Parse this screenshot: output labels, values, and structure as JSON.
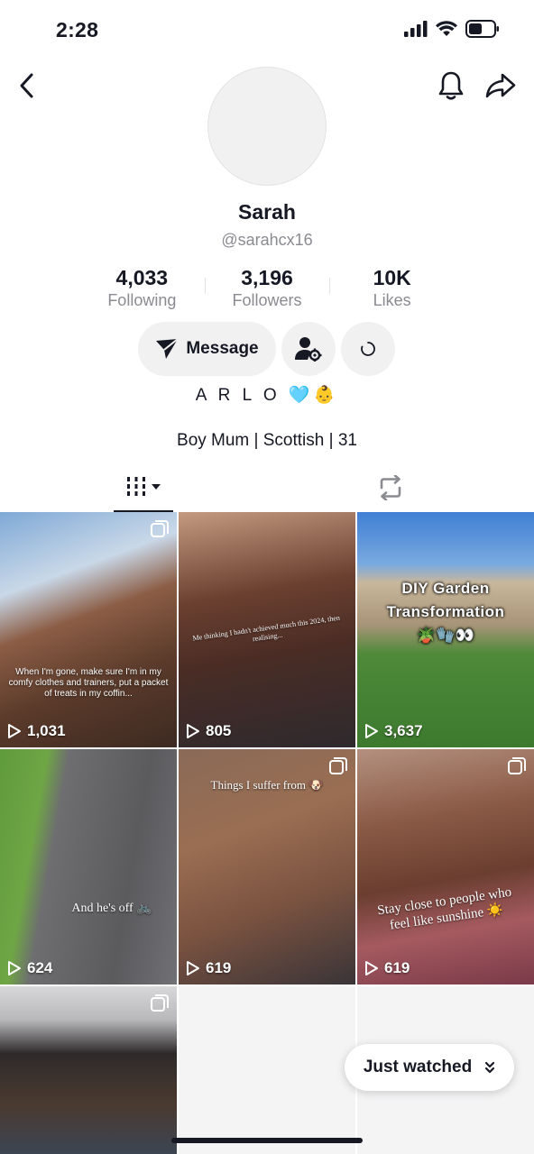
{
  "status_bar": {
    "time": "2:28"
  },
  "profile": {
    "display_name": "Sarah",
    "handle": "@sarahcx16",
    "bio_title": "A R L O 🩵👶",
    "bio_line": "Boy Mum | Scottish | 31"
  },
  "stats": [
    {
      "value": "4,033",
      "label": "Following"
    },
    {
      "value": "3,196",
      "label": "Followers"
    },
    {
      "value": "10K",
      "label": "Likes"
    }
  ],
  "actions": {
    "message_label": "Message"
  },
  "videos": [
    {
      "views": "1,031",
      "caption": "When I'm gone, make sure I'm in my comfy clothes and trainers, put a packet of treats in my coffin..."
    },
    {
      "views": "805",
      "caption": "Me thinking I hadn't achieved much this 2024, then realising..."
    },
    {
      "views": "3,637",
      "caption": "DIY Garden Transformation 🪴🧤👀"
    },
    {
      "views": "624",
      "caption": "And he's off 🚲"
    },
    {
      "views": "619",
      "caption": "Things I suffer from 🐶"
    },
    {
      "views": "619",
      "caption": "Stay close to people who feel like sunshine ☀️"
    }
  ],
  "just_watched": {
    "label": "Just watched"
  },
  "colors": {
    "text": "#161823",
    "secondary": "#8a8b91",
    "button_bg": "#f1f1f2"
  }
}
